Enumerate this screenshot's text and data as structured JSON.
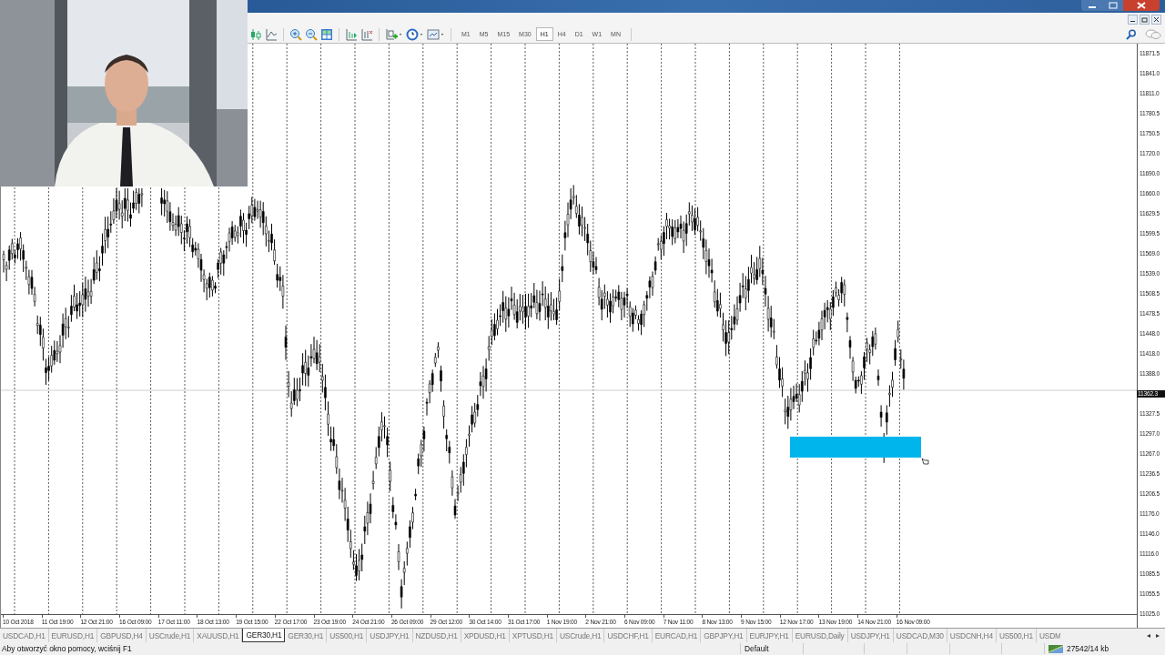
{
  "toolbar": {
    "timeframes": [
      {
        "label": "M1",
        "selected": false
      },
      {
        "label": "M5",
        "selected": false
      },
      {
        "label": "M15",
        "selected": false
      },
      {
        "label": "M30",
        "selected": false
      },
      {
        "label": "H1",
        "selected": true
      },
      {
        "label": "H4",
        "selected": false
      },
      {
        "label": "D1",
        "selected": false
      },
      {
        "label": "W1",
        "selected": false
      },
      {
        "label": "MN",
        "selected": false
      }
    ]
  },
  "chart": {
    "price_axis": [
      {
        "kind": "tick",
        "label": "11871.5"
      },
      {
        "kind": "tick",
        "label": "11841.0"
      },
      {
        "kind": "tick",
        "label": "11811.0"
      },
      {
        "kind": "tick",
        "label": "11780.5"
      },
      {
        "kind": "tick",
        "label": "11750.5"
      },
      {
        "kind": "tick",
        "label": "11720.0"
      },
      {
        "kind": "tick",
        "label": "11690.0"
      },
      {
        "kind": "tick",
        "label": "11660.0"
      },
      {
        "kind": "tick",
        "label": "11629.5"
      },
      {
        "kind": "tick",
        "label": "11599.5"
      },
      {
        "kind": "tick",
        "label": "11569.0"
      },
      {
        "kind": "tick",
        "label": "11539.0"
      },
      {
        "kind": "tick",
        "label": "11508.5"
      },
      {
        "kind": "tick",
        "label": "11478.5"
      },
      {
        "kind": "tick",
        "label": "11448.0"
      },
      {
        "kind": "tick",
        "label": "11418.0"
      },
      {
        "kind": "tick",
        "label": "11388.0"
      },
      {
        "kind": "current",
        "label": "11362.3"
      },
      {
        "kind": "tick",
        "label": "11327.5"
      },
      {
        "kind": "tick",
        "label": "11297.0"
      },
      {
        "kind": "tick",
        "label": "11267.0"
      },
      {
        "kind": "tick",
        "label": "11236.5"
      },
      {
        "kind": "tick",
        "label": "11206.5"
      },
      {
        "kind": "tick",
        "label": "11176.0"
      },
      {
        "kind": "tick",
        "label": "11146.0"
      },
      {
        "kind": "tick",
        "label": "11116.0"
      },
      {
        "kind": "tick",
        "label": "11085.5"
      },
      {
        "kind": "tick",
        "label": "11055.5"
      },
      {
        "kind": "tick",
        "label": "11025.0"
      }
    ],
    "time_labels": [
      "10 Oct 2018",
      "11 Oct 19:00",
      "12 Oct 21:00",
      "16 Oct 09:00",
      "17 Oct 11:00",
      "18 Oct 13:00",
      "19 Oct 15:00",
      "22 Oct 17:00",
      "23 Oct 19:00",
      "24 Oct 21:00",
      "26 Oct 09:00",
      "29 Oct 12:00",
      "30 Oct 14:00",
      "31 Oct 17:00",
      "1 Nov 19:00",
      "2 Nov 21:00",
      "6 Nov 09:00",
      "7 Nov 11:00",
      "8 Nov 13:00",
      "9 Nov 15:00",
      "12 Nov 17:00",
      "13 Nov 19:00",
      "14 Nov 21:00",
      "16 Nov 09:00"
    ]
  },
  "tabs": [
    {
      "label": "USDCAD,H1",
      "selected": false
    },
    {
      "label": "EURUSD,H1",
      "selected": false
    },
    {
      "label": "GBPUSD,H4",
      "selected": false
    },
    {
      "label": "USCrude,H1",
      "selected": false
    },
    {
      "label": "XAUUSD,H1",
      "selected": false
    },
    {
      "label": "GER30,H1",
      "selected": true
    },
    {
      "label": "GER30,H1",
      "selected": false
    },
    {
      "label": "US500,H1",
      "selected": false
    },
    {
      "label": "USDJPY,H1",
      "selected": false
    },
    {
      "label": "NZDUSD,H1",
      "selected": false
    },
    {
      "label": "XPDUSD,H1",
      "selected": false
    },
    {
      "label": "XPTUSD,H1",
      "selected": false
    },
    {
      "label": "USCrude,H1",
      "selected": false
    },
    {
      "label": "USDCHF,H1",
      "selected": false
    },
    {
      "label": "EURCAD,H1",
      "selected": false
    },
    {
      "label": "GBPJPY,H1",
      "selected": false
    },
    {
      "label": "EURJPY,H1",
      "selected": false
    },
    {
      "label": "EURUSD,Daily",
      "selected": false
    },
    {
      "label": "USDJPY,H1",
      "selected": false
    },
    {
      "label": "USDCAD,M30",
      "selected": false
    },
    {
      "label": "USDCNH,H4",
      "selected": false
    },
    {
      "label": "US500,H1",
      "selected": false
    },
    {
      "label": "USDM",
      "selected": false
    }
  ],
  "tab_scroll": [
    "◂",
    "▸"
  ],
  "status_bar": {
    "help": "Aby otworzyć okno pomocy, wciśnij F1",
    "profile": "Default",
    "traffic": "27542/14 kb"
  }
}
